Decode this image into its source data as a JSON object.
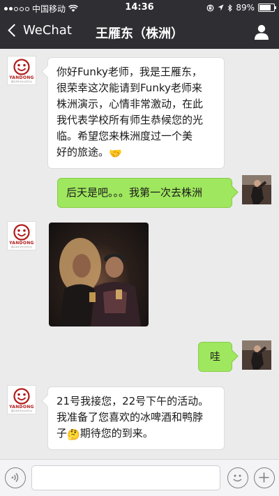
{
  "status_bar": {
    "carrier": "中国移动",
    "time": "14:36",
    "battery_text": "89%",
    "battery_level": 0.89,
    "signal_dots_filled": 2,
    "signal_dots_total": 5
  },
  "nav": {
    "back_label": "WeChat",
    "title": "王雁东（株洲）"
  },
  "messages": [
    {
      "direction": "incoming",
      "type": "text",
      "lines": [
        "你好Funky老师，我是王雁东，",
        "很荣幸这次能请到Funky老师来",
        "株洲演示，心情非常激动，在此",
        "我代表学校所有师生恭候您的光",
        "临。希望您来株洲度过一个美",
        "好的旅途。"
      ],
      "emoji": "🤝"
    },
    {
      "direction": "outgoing",
      "type": "text",
      "text": "后天是吧。。。我第一次去株洲"
    },
    {
      "direction": "incoming",
      "type": "image"
    },
    {
      "direction": "outgoing",
      "type": "text",
      "text": "哇"
    },
    {
      "direction": "incoming",
      "type": "text",
      "lines": [
        "21号我接您，22号下午的活动。",
        "我准备了您喜欢的冰啤酒和鸭脖"
      ],
      "line3_prefix": "子",
      "emoji": "🤔",
      "line3_suffix": "期待您的到来。"
    }
  ],
  "brand_avatar": {
    "name": "YANDONG",
    "subtitle": "雁东青年文化交流平台",
    "color": "#b01b1b"
  },
  "colors": {
    "bar_bg": "#2e2e33",
    "chat_bg": "#ebebeb",
    "outgoing_bubble": "#9fe75e",
    "incoming_bubble": "#ffffff"
  }
}
